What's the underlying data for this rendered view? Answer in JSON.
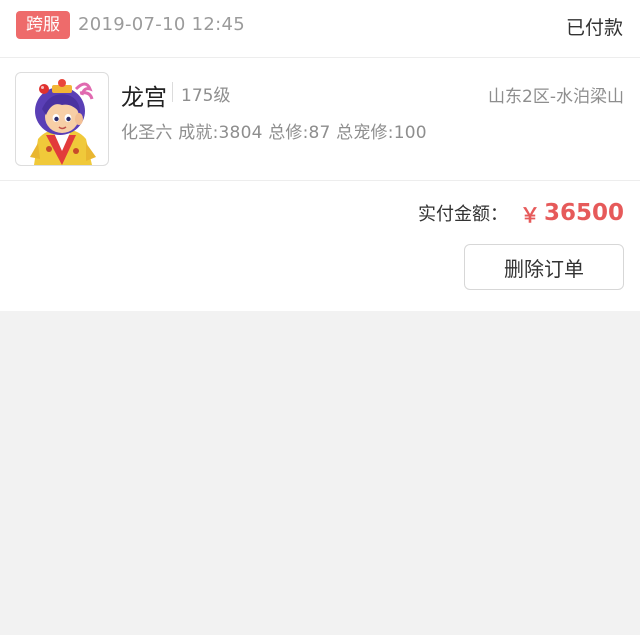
{
  "order": {
    "badge": "跨服",
    "time": "2019-07-10 12:45",
    "status": "已付款"
  },
  "product": {
    "thumbnail_icon": "character-avatar-icon",
    "name": "龙宫",
    "level": "175级",
    "server": "山东2区-水泊梁山",
    "stats": "化圣六 成就:3804 总修:87 总宠修:100"
  },
  "payment": {
    "label": "实付金额：",
    "currency": "￥",
    "amount": "36500"
  },
  "actions": {
    "delete_label": "删除订单"
  },
  "colors": {
    "badge_bg": "#ee6b6b",
    "price": "#e65a5a",
    "background": "#f2f2f2"
  }
}
